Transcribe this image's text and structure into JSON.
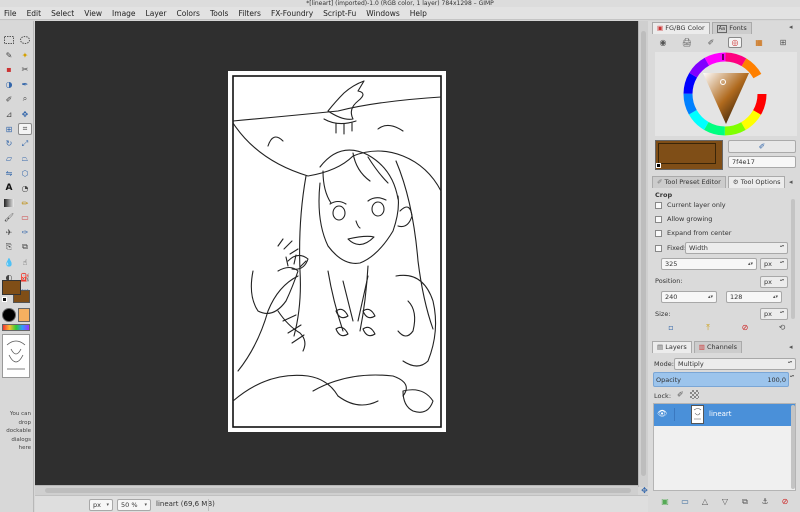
{
  "window": {
    "title": "*[lineart] (imported)-1.0 (RGB color, 1 layer) 784x1298 – GIMP"
  },
  "menu": [
    "File",
    "Edit",
    "Select",
    "View",
    "Image",
    "Layer",
    "Colors",
    "Tools",
    "Filters",
    "FX-Foundry",
    "Script-Fu",
    "Windows",
    "Help"
  ],
  "toolbox": {
    "tools": [
      "rect-select",
      "ellipse-select",
      "free-select",
      "fuzzy-select",
      "by-color-select",
      "scissors-select",
      "foreground-select",
      "paths",
      "color-picker",
      "zoom",
      "measure",
      "move",
      "align",
      "crop",
      "rotate",
      "scale",
      "shear",
      "perspective",
      "flip",
      "cage-transform",
      "text",
      "heal",
      "blend",
      "pencil",
      "paintbrush",
      "eraser",
      "airbrush",
      "ink",
      "clone",
      "perspective-clone",
      "blur",
      "smudge",
      "dodge-burn",
      "bucket-fill",
      "warp",
      "unified-transform"
    ],
    "hint_text": "You can drop dockable dialogs here"
  },
  "colors": {
    "foreground": "#7f4e17",
    "background": "#ffffff",
    "hex_value": "7f4e17"
  },
  "statusbar": {
    "unit": "px",
    "zoom": "50 %",
    "layer_info": "lineart (69,6 MB)"
  },
  "colors_dock": {
    "tabs": [
      "FG/BG Color",
      "Fonts"
    ]
  },
  "tool_options": {
    "tabs": [
      "Tool Preset Editor",
      "Tool Options"
    ],
    "title": "Crop",
    "current_layer_only": "Current layer only",
    "allow_growing": "Allow growing",
    "expand_from_center": "Expand from center",
    "fixed_label": "Fixed:",
    "fixed_value": "Width",
    "fixed_number": "325",
    "unit": "px",
    "position_label": "Position:",
    "position_x": "240",
    "position_y": "128",
    "size_label": "Size:"
  },
  "layers": {
    "tabs": [
      "Layers",
      "Channels"
    ],
    "mode_label": "Mode:",
    "mode_value": "Multiply",
    "opacity_label": "Opacity",
    "opacity_value": "100,0",
    "lock_label": "Lock:",
    "items": [
      {
        "name": "lineart"
      }
    ]
  }
}
